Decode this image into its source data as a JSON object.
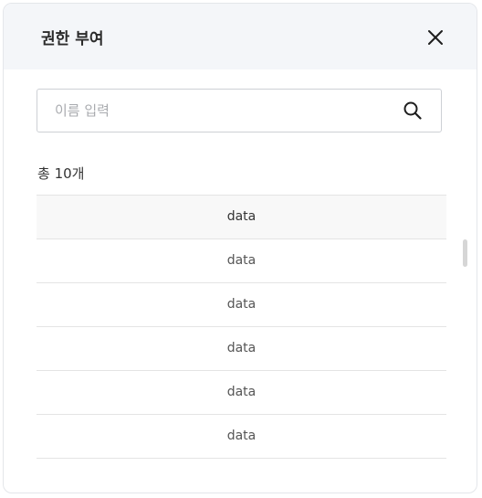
{
  "dialog": {
    "title": "권한 부여"
  },
  "search": {
    "placeholder": "이름 입력",
    "value": ""
  },
  "list": {
    "total_label": "총 10개",
    "header": "data",
    "rows": [
      "data",
      "data",
      "data",
      "data",
      "data"
    ]
  },
  "icons": {
    "close": "close-icon",
    "search": "search-icon"
  },
  "colors": {
    "header_bg": "#f4f6f9",
    "border": "#e4e4e4",
    "text": "#333333"
  }
}
